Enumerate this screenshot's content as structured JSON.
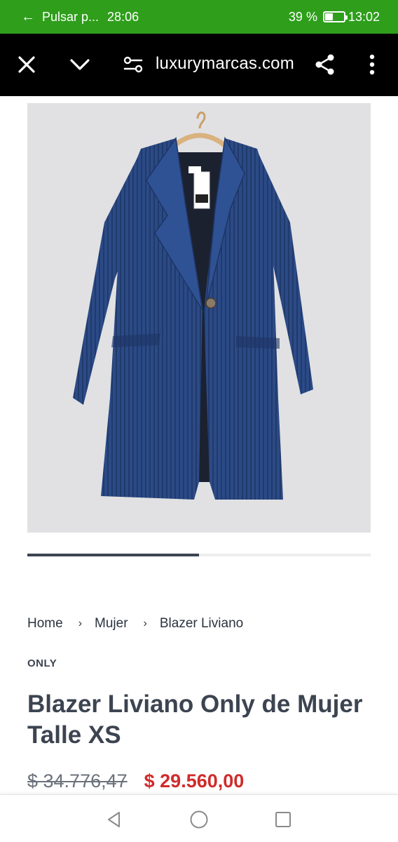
{
  "status_bar": {
    "back_label": "Pulsar p...",
    "timer": "28:06",
    "battery_percent": "39 %",
    "battery_level": 0.39,
    "clock": "13:02"
  },
  "browser": {
    "url": "luxurymarcas.com",
    "icons": [
      "close-icon",
      "chevron-down-icon",
      "tune-icon",
      "share-icon",
      "more-vert-icon"
    ]
  },
  "gallery": {
    "current_slide": 1,
    "total_slides": 2
  },
  "breadcrumb": {
    "items": [
      "Home",
      "Mujer",
      "Blazer Liviano"
    ],
    "separator": "›"
  },
  "product": {
    "vendor": "ONLY",
    "title": "Blazer Liviano Only de Mujer Talle XS",
    "compare_price": "$ 34.776,47",
    "price": "$ 29.560,00"
  },
  "colors": {
    "status_bar": "#2e9e1b",
    "toolbar": "#000000",
    "price_sale": "#d02b2b",
    "text_primary": "#3c4451",
    "coat_blue": "#2b4a86"
  },
  "nav_bar": {
    "icons": [
      "back-triangle-icon",
      "home-circle-icon",
      "recents-square-icon"
    ]
  }
}
